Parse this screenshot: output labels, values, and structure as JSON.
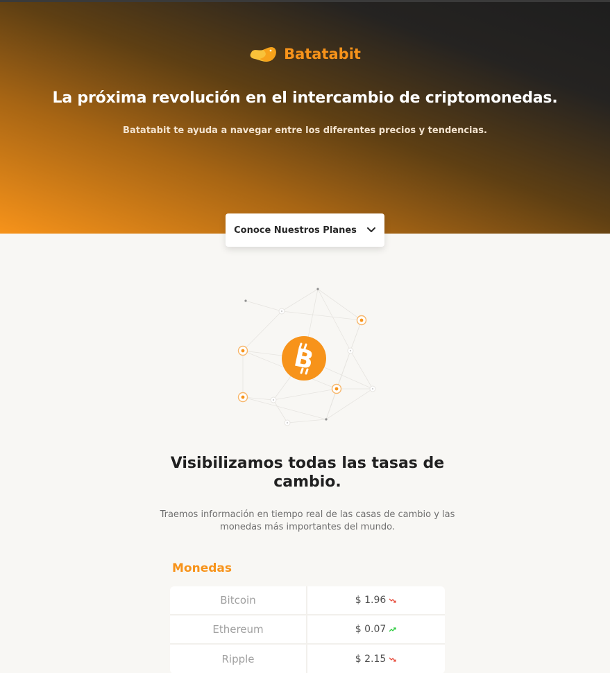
{
  "brand": {
    "name": "Batatabit",
    "accent": "#f7931a"
  },
  "hero": {
    "title": "La próxima revolución en el intercambio de criptomonedas.",
    "subtitle": "Batatabit te ayuda a navegar entre los diferentes precios y tendencias.",
    "cta_label": "Conoce Nuestros Planes",
    "cta_icon": "chevron-down-icon"
  },
  "illustration": {
    "icon": "bitcoin-icon"
  },
  "section": {
    "title": "Visibilizamos todas las tasas de cambio.",
    "subtitle": "Traemos información en tiempo real de las casas de cambio y las monedas más importantes del mundo."
  },
  "currencies": {
    "label": "Monedas",
    "rows": [
      {
        "name": "Bitcoin",
        "price": "$ 1.96",
        "trend": "down",
        "trend_color": "#e74c3c"
      },
      {
        "name": "Ethereum",
        "price": "$ 0.07",
        "trend": "up",
        "trend_color": "#2ecc40"
      },
      {
        "name": "Ripple",
        "price": "$ 2.15",
        "trend": "down",
        "trend_color": "#e74c3c"
      }
    ]
  }
}
